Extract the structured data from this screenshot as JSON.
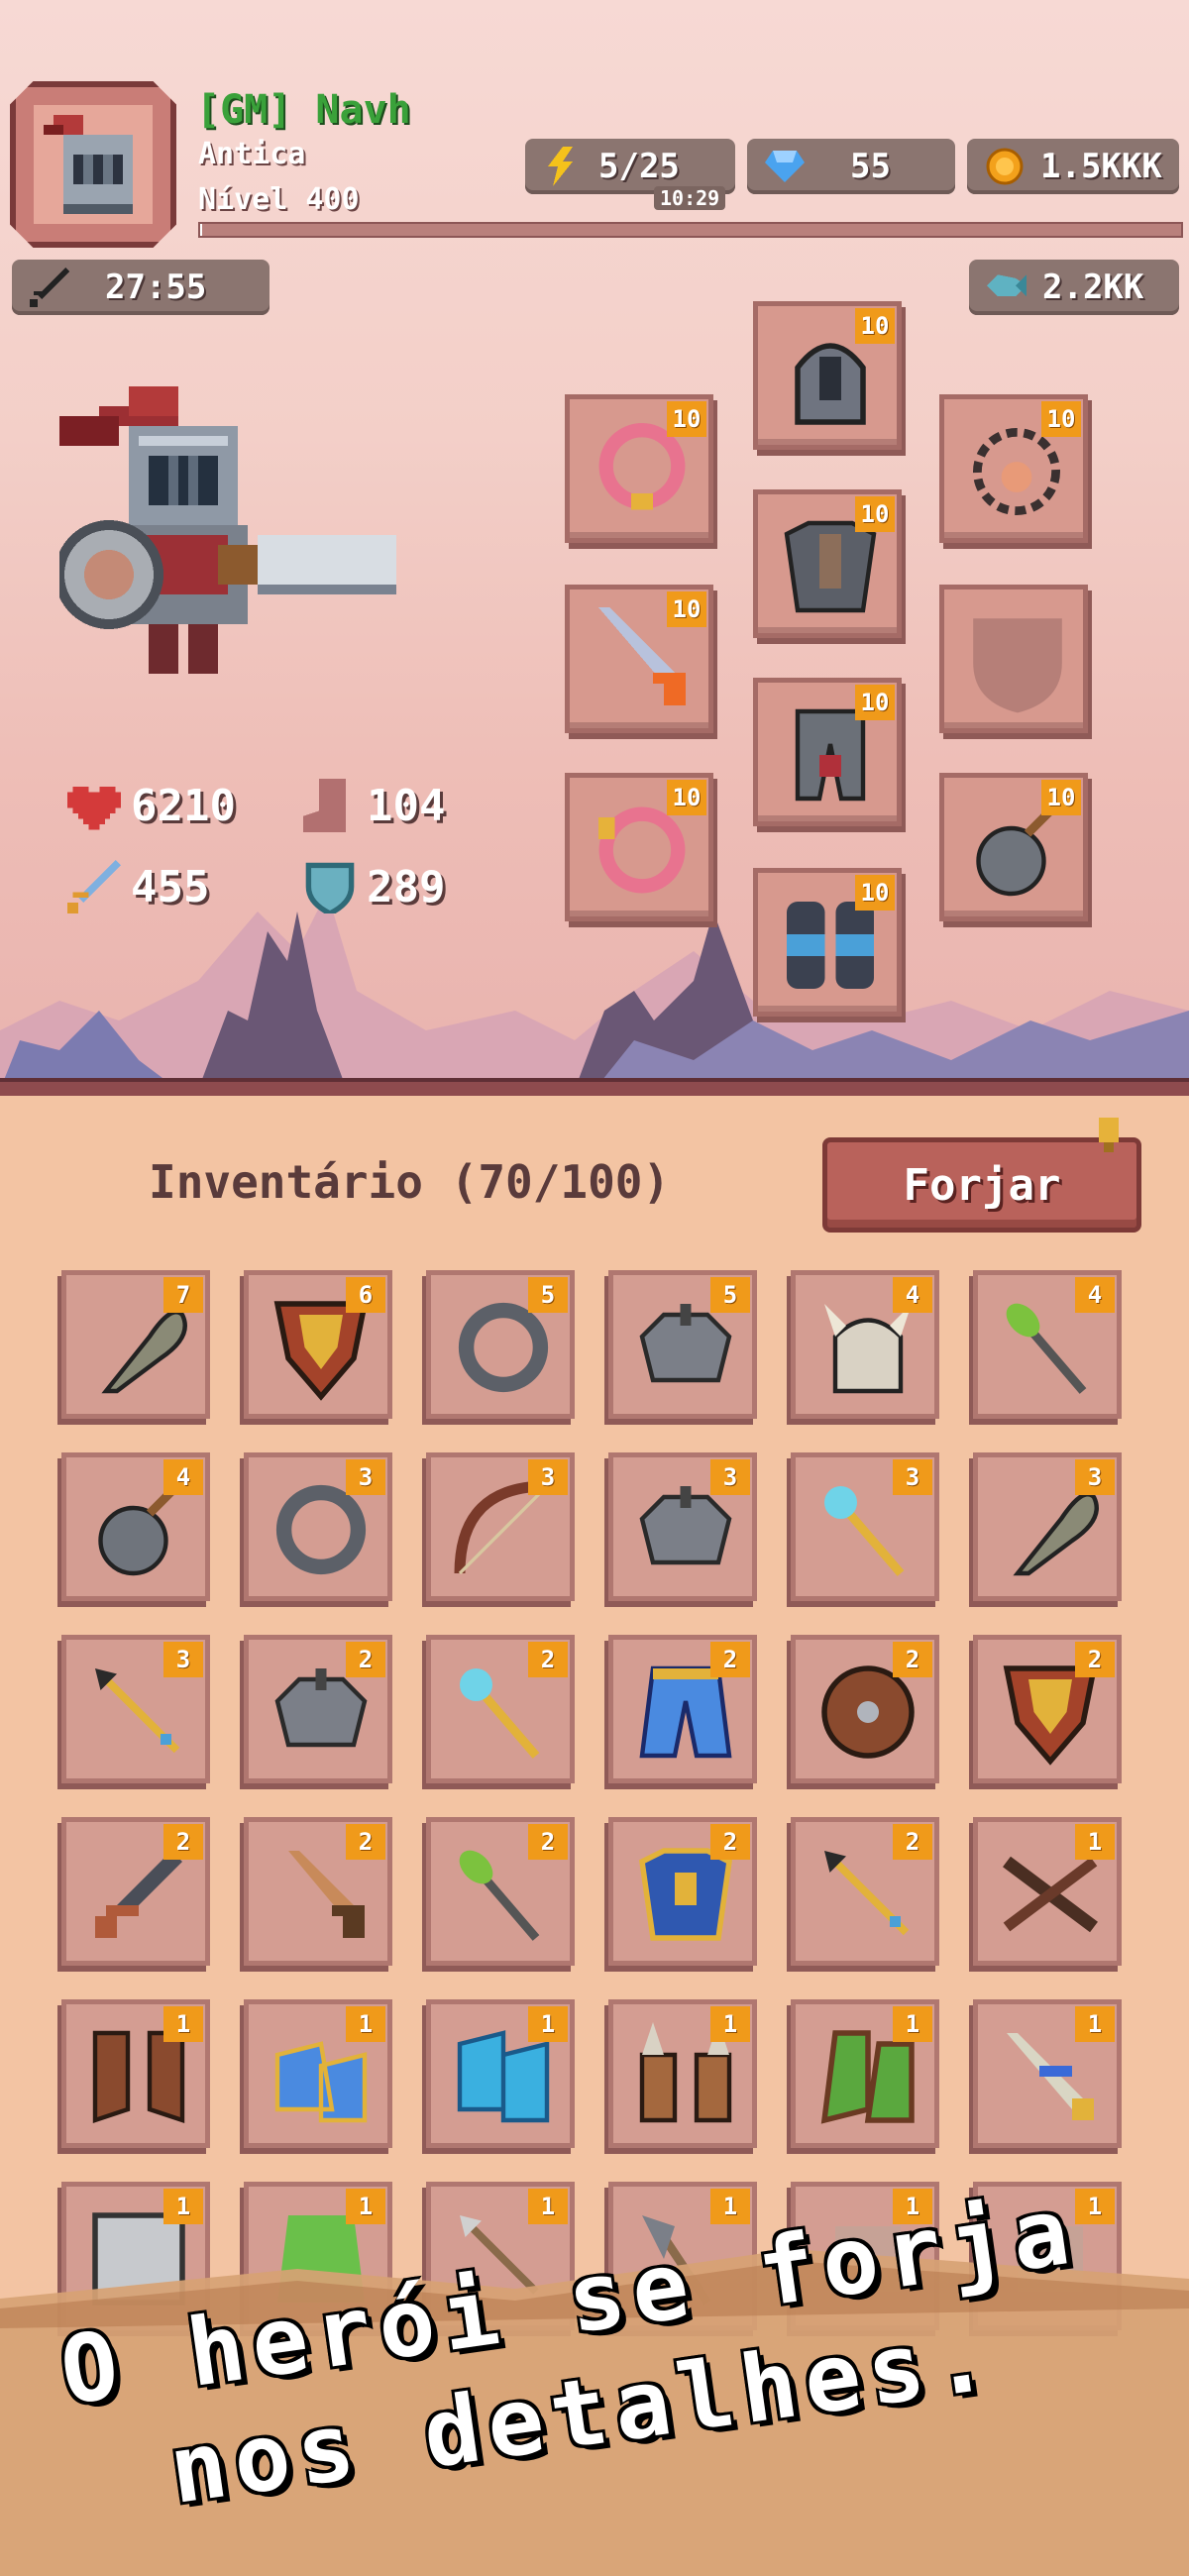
{
  "player": {
    "name": "[GM] Navh",
    "server": "Antica",
    "level": "Nível 400"
  },
  "resources": {
    "energy": "5/25",
    "energy_timer": "10:29",
    "gems": "55",
    "gold": "1.5KKK",
    "fish": "2.2KK"
  },
  "timer": "27:55",
  "stats": {
    "health": "6210",
    "armor_boot": "104",
    "attack": "455",
    "defense": "289"
  },
  "equipment": [
    {
      "name": "ring",
      "count": "10"
    },
    {
      "name": "amulet",
      "count": "10"
    },
    {
      "name": "helmet",
      "count": "10"
    },
    {
      "name": "necklace",
      "count": "10"
    },
    {
      "name": "armor",
      "count": "10"
    },
    {
      "name": "sword",
      "count": "10"
    },
    {
      "name": "legs",
      "count": "10"
    },
    {
      "name": "empty-shield",
      "count": ""
    },
    {
      "name": "ring2",
      "count": "10"
    },
    {
      "name": "boots",
      "count": "10"
    },
    {
      "name": "bomb-amulet",
      "count": "10"
    }
  ],
  "inventory": {
    "title": "Inventário (70/100)",
    "forge_label": "Forjar",
    "items": [
      {
        "icon": "club",
        "count": "7"
      },
      {
        "icon": "shield",
        "count": "6"
      },
      {
        "icon": "ring",
        "count": "5"
      },
      {
        "icon": "spiked-armor",
        "count": "5"
      },
      {
        "icon": "horned-helmet",
        "count": "4"
      },
      {
        "icon": "green-staff",
        "count": "4"
      },
      {
        "icon": "bomb",
        "count": "4"
      },
      {
        "icon": "ring",
        "count": "3"
      },
      {
        "icon": "bow",
        "count": "3"
      },
      {
        "icon": "spiked-armor",
        "count": "3"
      },
      {
        "icon": "crystal-wand",
        "count": "3"
      },
      {
        "icon": "club",
        "count": "3"
      },
      {
        "icon": "spear",
        "count": "3"
      },
      {
        "icon": "spiked-armor",
        "count": "2"
      },
      {
        "icon": "crystal-wand",
        "count": "2"
      },
      {
        "icon": "blue-pants",
        "count": "2"
      },
      {
        "icon": "round-shield",
        "count": "2"
      },
      {
        "icon": "shield",
        "count": "2"
      },
      {
        "icon": "iron-sword",
        "count": "2"
      },
      {
        "icon": "wood-sword",
        "count": "2"
      },
      {
        "icon": "green-staff",
        "count": "2"
      },
      {
        "icon": "royal-armor",
        "count": "2"
      },
      {
        "icon": "spear",
        "count": "2"
      },
      {
        "icon": "crossbow",
        "count": "1"
      },
      {
        "icon": "leather-boots",
        "count": "1"
      },
      {
        "icon": "blue-boots",
        "count": "1"
      },
      {
        "icon": "ice-boots",
        "count": "1"
      },
      {
        "icon": "horned-boots",
        "count": "1"
      },
      {
        "icon": "green-boots",
        "count": "1"
      },
      {
        "icon": "gold-sword",
        "count": "1"
      },
      {
        "icon": "metal-plate",
        "count": "1"
      },
      {
        "icon": "green-cloak",
        "count": "1"
      },
      {
        "icon": "arrow",
        "count": "1"
      },
      {
        "icon": "axe",
        "count": "1"
      },
      {
        "icon": "misc",
        "count": "1"
      },
      {
        "icon": "misc",
        "count": "1"
      }
    ]
  },
  "slogan": {
    "line1": "O herói se forja",
    "line2": "nos detalhes."
  },
  "colors": {
    "badge": "#f09a1a",
    "name_green": "#3aa13a",
    "slot_bg": "#d49d92",
    "panel": "#f3c4a3"
  }
}
